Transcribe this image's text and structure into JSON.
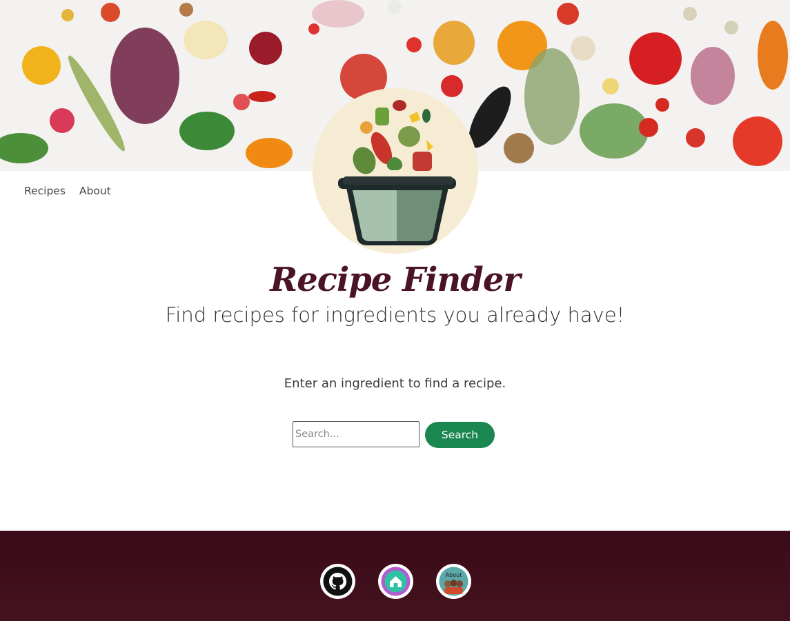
{
  "nav": {
    "items": [
      {
        "label": "Recipes"
      },
      {
        "label": "About"
      }
    ]
  },
  "header": {
    "title": "Recipe Finder",
    "subtitle": "Find recipes for ingredients you already have!"
  },
  "search": {
    "prompt": "Enter an ingredient to find a recipe.",
    "placeholder": "Search...",
    "value": "",
    "button_label": "Search"
  },
  "footer": {
    "links": [
      {
        "icon": "github-icon"
      },
      {
        "icon": "home-icon"
      },
      {
        "icon": "about-icon",
        "label": "About"
      }
    ]
  },
  "colors": {
    "title": "#4a1426",
    "accent": "#1a8650",
    "footer": "#3a0b18",
    "logo_bg": "#f5ecd3"
  }
}
